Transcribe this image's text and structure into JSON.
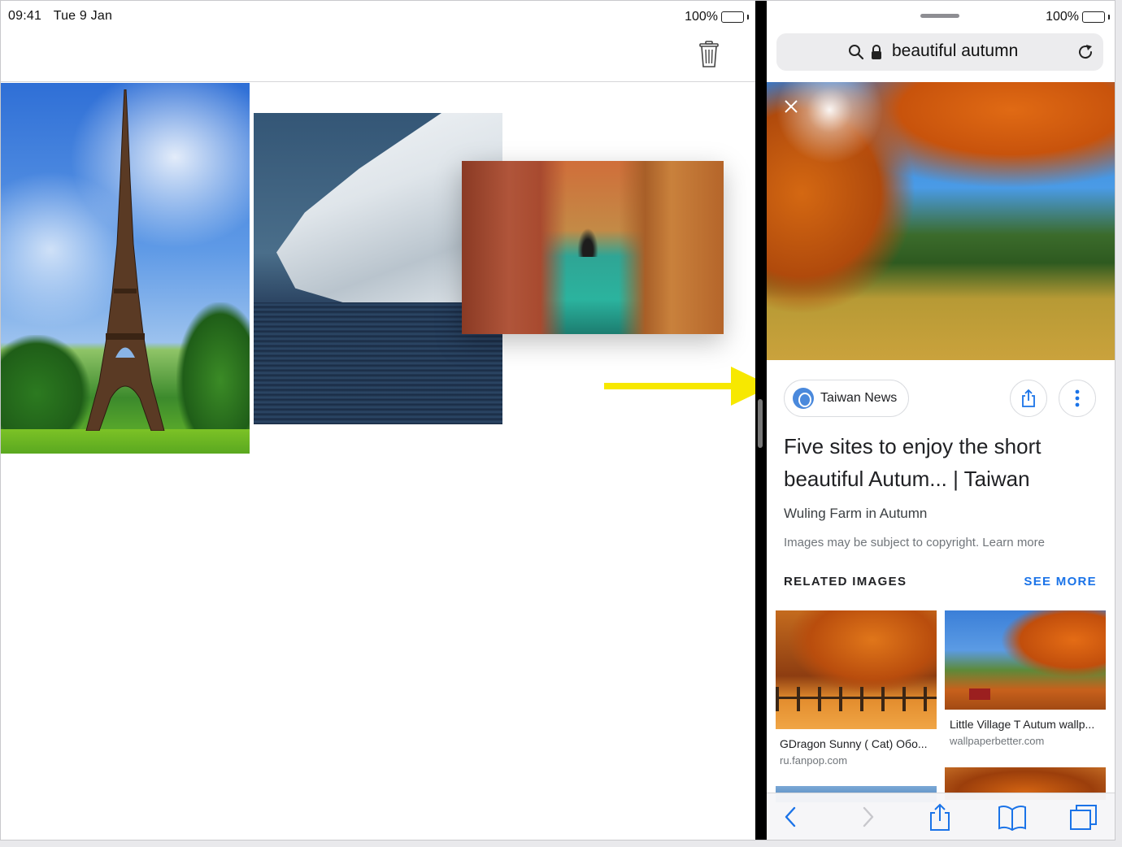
{
  "status_bar": {
    "time": "09:41",
    "date": "Tue 9 Jan",
    "battery_left": "100%",
    "battery_right": "100%",
    "battery_level": 1.0
  },
  "left_app": {
    "toolbar": {
      "trash_icon": "trash-icon"
    },
    "photos": [
      {
        "subject": "eiffel-tower"
      },
      {
        "subject": "iceberg"
      },
      {
        "subject": "venice-canal"
      }
    ],
    "drag_arrow_color": "#f7e800"
  },
  "browser": {
    "url_text": "beautiful autumn",
    "icons": [
      "search-icon",
      "lock-icon",
      "reload-icon",
      "close-icon"
    ],
    "result": {
      "source_name": "Taiwan News",
      "title": "Five sites to enjoy the short beautiful Autum... | Taiwan",
      "subtitle": "Wuling Farm in Autumn",
      "copyright": "Images may be subject to copyright. Learn more"
    },
    "related": {
      "header": "RELATED IMAGES",
      "see_more": "SEE MORE",
      "items": [
        {
          "caption": "GDragon Sunny ( Cat) Обо...",
          "domain": "ru.fanpop.com"
        },
        {
          "caption": "Little Village T Autum wallp...",
          "domain": "wallpaperbetter.com"
        }
      ]
    },
    "toolbar_icons": [
      "back-icon",
      "forward-icon",
      "share-icon",
      "bookmarks-icon",
      "tabs-icon"
    ]
  },
  "colors": {
    "accent_blue": "#1a73e8",
    "battery_green": "#4cd964",
    "divider": "#000000"
  }
}
